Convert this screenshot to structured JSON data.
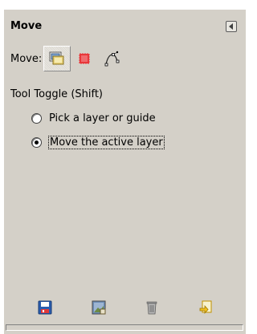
{
  "panel": {
    "title": "Move"
  },
  "move_mode": {
    "label": "Move:",
    "modes": [
      {
        "icon": "layer-icon",
        "selected": true
      },
      {
        "icon": "selection-icon",
        "selected": false
      },
      {
        "icon": "path-icon",
        "selected": false
      }
    ]
  },
  "tool_toggle": {
    "label": "Tool Toggle  (Shift)",
    "options": [
      {
        "label": "Pick a layer or guide",
        "checked": false
      },
      {
        "label": "Move the active layer",
        "checked": true
      }
    ]
  },
  "bottom_actions": [
    {
      "icon": "save-icon"
    },
    {
      "icon": "restore-icon"
    },
    {
      "icon": "delete-icon"
    },
    {
      "icon": "reset-icon"
    }
  ],
  "colors": {
    "panel_bg": "#d4d0c8",
    "selection_red": "#e8363a",
    "save_blue": "#2a5db0",
    "reset_yellow": "#f0c020"
  }
}
